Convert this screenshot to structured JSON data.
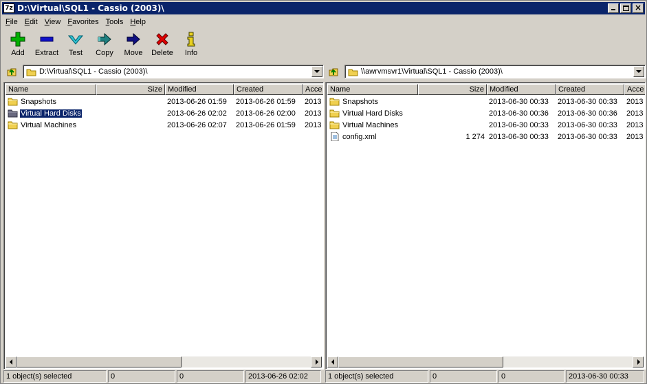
{
  "window": {
    "title": "D:\\Virtual\\SQL1 - Cassio (2003)\\",
    "app_icon_text": "7z"
  },
  "menu": [
    {
      "label": "File",
      "underline": "F",
      "rest": "ile"
    },
    {
      "label": "Edit",
      "underline": "E",
      "rest": "dit"
    },
    {
      "label": "View",
      "underline": "V",
      "rest": "iew"
    },
    {
      "label": "Favorites",
      "underline": "F",
      "rest": "avorites",
      "prefix": ""
    },
    {
      "label": "Tools",
      "underline": "T",
      "rest": "ools"
    },
    {
      "label": "Help",
      "underline": "H",
      "rest": "elp"
    }
  ],
  "toolbar": {
    "add": "Add",
    "extract": "Extract",
    "test": "Test",
    "copy": "Copy",
    "move": "Move",
    "delete": "Delete",
    "info": "Info",
    "colors": {
      "add": "#00b000",
      "extract": "#1010c8",
      "test": "#30c0d0",
      "copy": "#208080",
      "move": "#101080",
      "delete": "#e00000",
      "info": "#e8d020"
    }
  },
  "columns": {
    "name": "Name",
    "size": "Size",
    "modified": "Modified",
    "created": "Created",
    "accessed": "Acce"
  },
  "left": {
    "path": "D:\\Virtual\\SQL1 - Cassio (2003)\\",
    "rows": [
      {
        "name": "Snapshots",
        "icon": "folder-icon",
        "size": "",
        "modified": "2013-06-26 01:59",
        "created": "2013-06-26 01:59",
        "accessed": "2013"
      },
      {
        "name": "Virtual Hard Disks",
        "icon": "folder-selected-icon",
        "size": "",
        "modified": "2013-06-26 02:02",
        "created": "2013-06-26 02:00",
        "accessed": "2013",
        "selected": true
      },
      {
        "name": "Virtual Machines",
        "icon": "folder-icon",
        "size": "",
        "modified": "2013-06-26 02:07",
        "created": "2013-06-26 01:59",
        "accessed": "2013"
      }
    ],
    "status": {
      "selected": "1 object(s) selected",
      "size": "0",
      "packed": "0",
      "modified": "2013-06-26 02:02"
    }
  },
  "right": {
    "path": "\\\\awrvmsvr1\\Virtual\\SQL1 - Cassio (2003)\\",
    "rows": [
      {
        "name": "Snapshots",
        "icon": "folder-icon",
        "size": "",
        "modified": "2013-06-30 00:33",
        "created": "2013-06-30 00:33",
        "accessed": "2013"
      },
      {
        "name": "Virtual Hard Disks",
        "icon": "folder-icon",
        "size": "",
        "modified": "2013-06-30 00:36",
        "created": "2013-06-30 00:36",
        "accessed": "2013"
      },
      {
        "name": "Virtual Machines",
        "icon": "folder-icon",
        "size": "",
        "modified": "2013-06-30 00:33",
        "created": "2013-06-30 00:33",
        "accessed": "2013"
      },
      {
        "name": "config.xml",
        "icon": "xml-file-icon",
        "size": "1 274",
        "modified": "2013-06-30 00:33",
        "created": "2013-06-30 00:33",
        "accessed": "2013"
      }
    ],
    "status": {
      "selected": "1 object(s) selected",
      "size": "0",
      "packed": "0",
      "modified": "2013-06-30 00:33"
    }
  }
}
